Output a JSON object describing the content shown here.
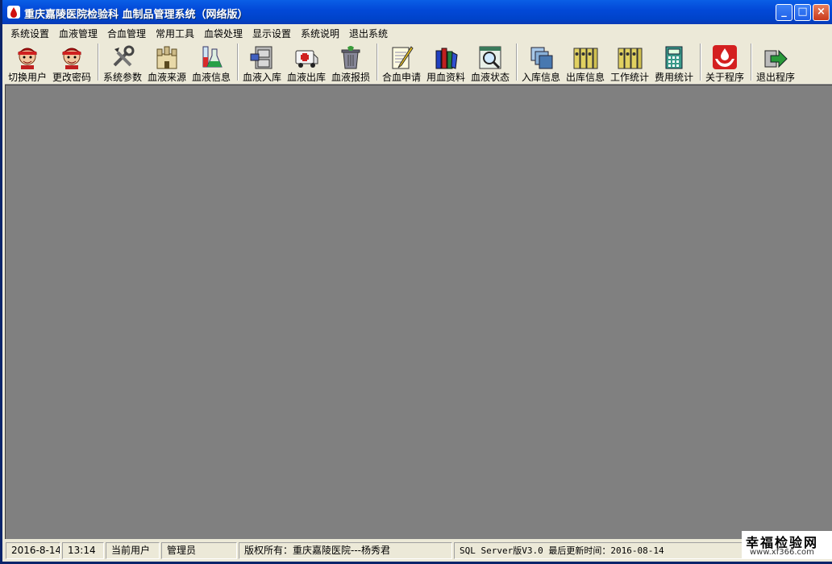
{
  "window": {
    "title": "重庆嘉陵医院检验科 血制品管理系统（网络版）",
    "controls": {
      "minimize": "_",
      "maximize": "□",
      "close": "×"
    }
  },
  "menu": {
    "items": [
      "系统设置",
      "血液管理",
      "合血管理",
      "常用工具",
      "血袋处理",
      "显示设置",
      "系统说明",
      "退出系统"
    ]
  },
  "toolbar": {
    "tools": [
      {
        "label": "切换用户",
        "icon": "user-switch-icon"
      },
      {
        "label": "更改密码",
        "icon": "change-password-icon"
      },
      {
        "label": "系统参数",
        "icon": "tools-icon"
      },
      {
        "label": "血液来源",
        "icon": "castle-icon"
      },
      {
        "label": "血液信息",
        "icon": "flask-icon"
      },
      {
        "label": "血液入库",
        "icon": "cabinet-icon"
      },
      {
        "label": "血液出库",
        "icon": "ambulance-icon"
      },
      {
        "label": "血液报损",
        "icon": "trash-icon"
      },
      {
        "label": "合血申请",
        "icon": "notepad-icon"
      },
      {
        "label": "用血资料",
        "icon": "books-icon"
      },
      {
        "label": "血液状态",
        "icon": "magnifier-icon"
      },
      {
        "label": "入库信息",
        "icon": "stack-icon"
      },
      {
        "label": "出库信息",
        "icon": "binders-icon"
      },
      {
        "label": "工作统计",
        "icon": "binders-icon"
      },
      {
        "label": "费用统计",
        "icon": "calculator-icon"
      },
      {
        "label": "关于程序",
        "icon": "hands-blood-icon"
      },
      {
        "label": "退出程序",
        "icon": "exit-arrow-icon"
      }
    ]
  },
  "status": {
    "date": "2016-8-14",
    "time": "13:14",
    "user_label": "当前用户",
    "user": "管理员",
    "copyright": "版权所有：重庆嘉陵医院---杨秀君",
    "version": "SQL Server版V3.0 最后更新时间：2016-08-14"
  },
  "watermark": {
    "title": "幸福检验网",
    "url": "www.xf366.com"
  }
}
